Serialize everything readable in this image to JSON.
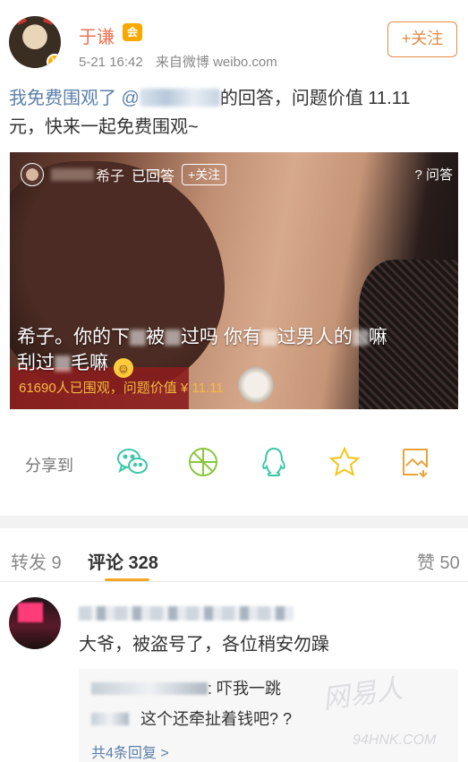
{
  "post": {
    "username": "于谦",
    "vip_badge": "会",
    "timestamp": "5-21 16:42",
    "source": "来自微博 weibo.com",
    "follow_label": "+关注",
    "text_prefix": "我免费围观了 @",
    "text_middle": "的回答，问题价值 11.11",
    "text_line2": "元，快来一起免费围观~"
  },
  "answer_card": {
    "answerer_suffix": "希子",
    "answered_label": "已回答",
    "follow_label": "+关注",
    "ask_label": "? 问答",
    "question_part1": "希子。你的下",
    "question_part2": "被",
    "question_part3": "过吗 你有",
    "question_part4": "过男人的",
    "question_part5": "嘛",
    "question_part6": "刮过",
    "question_part7": "毛嘛",
    "stats": "61690人已围观，问题价值 ¥ 11.11"
  },
  "share": {
    "label": "分享到",
    "icons": [
      "wechat-icon",
      "moments-icon",
      "qq-icon",
      "qzone-icon",
      "save-image-icon"
    ],
    "color": "#3cc8a6"
  },
  "tabs": {
    "repost": "转发 9",
    "comments": "评论 328",
    "likes": "赞 50"
  },
  "comment": {
    "text": "大爷，被盗号了，各位稍安勿躁",
    "reply1": ": 吓我一跳",
    "reply2": "这个还牵扯着钱吧? ?",
    "more": "共4条回复 >"
  },
  "watermark": {
    "main": "网易人",
    "sub": "94HNK.COM"
  },
  "colors": {
    "accent": "#eb7350",
    "follow": "#e28c48",
    "link": "#5b7fa8",
    "tab_indicator": "#f5a623",
    "stats": "#f6b93f"
  }
}
